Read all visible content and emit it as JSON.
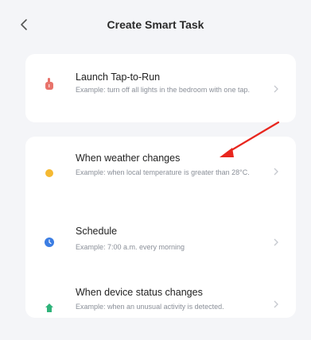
{
  "header": {
    "title": "Create Smart Task",
    "back_icon": "chevron-left-icon"
  },
  "sections": [
    {
      "items": [
        {
          "title": "Launch Tap-to-Run",
          "description": "Example: turn off all lights in the bedroom with one tap.",
          "icon": "hand-tap-icon",
          "icon_color": "#e8736b"
        }
      ]
    },
    {
      "items": [
        {
          "title": "When weather changes",
          "description": "Example: when local temperature is greater than 28°C.",
          "icon": "sun-icon",
          "icon_color": "#f5b932"
        },
        {
          "title": "Schedule",
          "description": "Example: 7:00 a.m. every morning",
          "icon": "clock-icon",
          "icon_color": "#3b7de3"
        },
        {
          "title": "When device status changes",
          "description": "Example: when an unusual activity is detected.",
          "icon": "device-icon",
          "icon_color": "#2fb37a"
        }
      ]
    }
  ],
  "annotation": {
    "arrow_color": "#e8261e"
  }
}
